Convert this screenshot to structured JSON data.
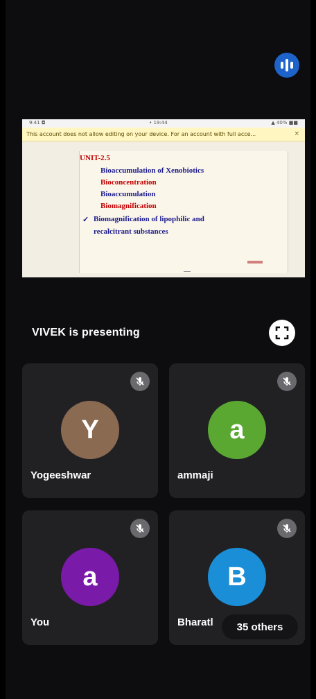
{
  "share": {
    "status_left": "9:41 ◘",
    "status_center": "• 19:44",
    "status_right": "▲ 40% ■■",
    "banner": "This account does not allow editing on your device. For an account with full acce...",
    "banner_close": "×",
    "slide": {
      "unit": "UNIT-2.5",
      "items": [
        {
          "text": "Bioaccumulation of Xenobiotics"
        },
        {
          "text": "Bioconcentration"
        },
        {
          "text": "Bioaccumulation"
        },
        {
          "text": "Biomagnification"
        }
      ],
      "check": "✓",
      "line5": "Biomagnification of lipophilic and",
      "line6": "recalcitrant substances"
    }
  },
  "presenting_label": "VIVEK is presenting",
  "participants": [
    {
      "name": "Yogeeshwar",
      "initial": "Y",
      "color": "#8b6a52"
    },
    {
      "name": "ammaji",
      "initial": "a",
      "color": "#5aa832"
    },
    {
      "name": "You",
      "initial": "a",
      "color": "#7a1aa8"
    },
    {
      "name": "Bharatl",
      "initial": "B",
      "color": "#1a8fd8"
    }
  ],
  "others_label": "35 others",
  "colors": {
    "background": "#0d0d0f",
    "tile": "#212124",
    "audio_button": "#1e63c9",
    "slide_blue": "#1a1a8c",
    "slide_red": "#c00000"
  },
  "icons": {
    "audio": "audio-level-icon",
    "fullscreen": "fullscreen-icon",
    "mute": "mic-off-icon"
  }
}
